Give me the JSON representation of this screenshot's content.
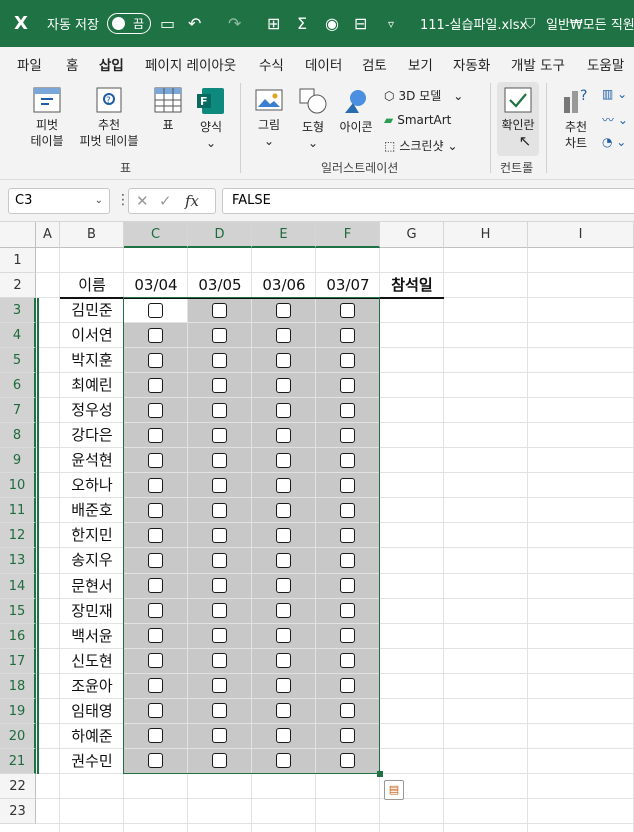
{
  "titlebar": {
    "autosave_label": "자동 저장",
    "autosave_state": "끔",
    "filename": "111-실습파일.xlsx",
    "sensitivity": "일반₩모든 직원("
  },
  "tabs": [
    "파일",
    "홈",
    "삽입",
    "페이지 레이아웃",
    "수식",
    "데이터",
    "검토",
    "보기",
    "자동화",
    "개발 도구",
    "도움말"
  ],
  "active_tab": "삽입",
  "ribbon": {
    "pivot_table_l1": "피벗",
    "pivot_table_l2": "테이블",
    "rec_pivot_l1": "추천",
    "rec_pivot_l2": "피벗 테이블",
    "table": "표",
    "forms": "양식",
    "tables_group": "표",
    "pictures": "그림",
    "shapes": "도형",
    "icons": "아이콘",
    "model3d": "3D 모델",
    "smartart": "SmartArt",
    "screenshot": "스크린샷",
    "illustrations_group": "일러스트레이션",
    "checkbox": "확인란",
    "controls_group": "컨트롤",
    "rec_charts_l1": "추천",
    "rec_charts_l2": "차트"
  },
  "formula_bar": {
    "name_box": "C3",
    "fx": "fx",
    "value": "FALSE"
  },
  "columns": [
    "A",
    "B",
    "C",
    "D",
    "E",
    "F",
    "G",
    "H",
    "I"
  ],
  "rows": [
    "1",
    "2",
    "3",
    "4",
    "5",
    "6",
    "7",
    "8",
    "9",
    "10",
    "11",
    "12",
    "13",
    "14",
    "15",
    "16",
    "17",
    "18",
    "19",
    "20",
    "21",
    "22",
    "23"
  ],
  "sheet": {
    "header_name": "이름",
    "dates": [
      "03/04",
      "03/05",
      "03/06",
      "03/07"
    ],
    "attend_header": "참석일",
    "names": [
      "김민준",
      "이서연",
      "박지훈",
      "최예린",
      "정우성",
      "강다은",
      "윤석현",
      "오하나",
      "배준호",
      "한지민",
      "송지우",
      "문현서",
      "장민재",
      "백서윤",
      "신도현",
      "조윤아",
      "임태영",
      "하예준",
      "권수민"
    ],
    "checkbox_value": "FALSE"
  }
}
